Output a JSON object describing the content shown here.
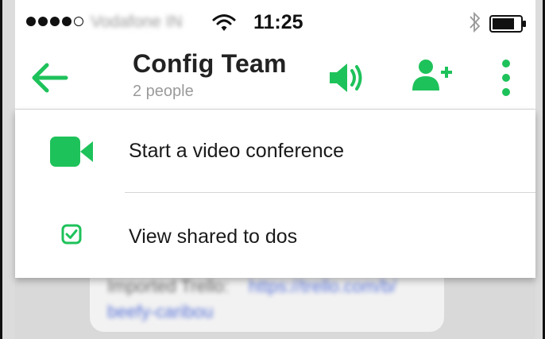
{
  "status_bar": {
    "carrier": "Vodafone IN",
    "time": "11:25",
    "signal_filled": 4,
    "signal_total": 5
  },
  "header": {
    "title": "Config Team",
    "subtitle": "2 people"
  },
  "menu": {
    "items": [
      {
        "label": "Start a video conference",
        "icon": "video-camera-icon"
      },
      {
        "label": "View shared to dos",
        "icon": "checkbox-icon"
      }
    ]
  },
  "background_chat": {
    "line1_text": "Imported Trello:",
    "line1_link": "https://trello.com/b/",
    "line2_link": "beefy-caribou"
  },
  "colors": {
    "accent": "#1ec25a",
    "text": "#1a1a1a",
    "muted": "#9a9a9a"
  }
}
